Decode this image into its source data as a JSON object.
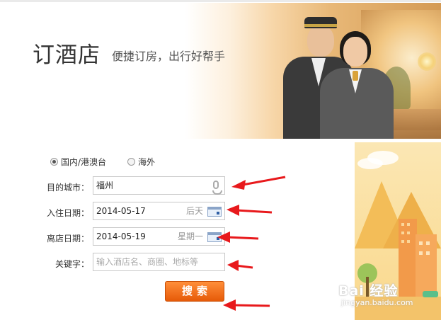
{
  "header": {
    "title": "订酒店",
    "subtitle": "便捷订房，出行好帮手"
  },
  "region": {
    "options": [
      {
        "label": "国内/港澳台",
        "selected": true
      },
      {
        "label": "海外",
        "selected": false
      }
    ]
  },
  "form": {
    "city": {
      "label": "目的城市：",
      "value": "福州",
      "icon": "microphone-icon"
    },
    "checkin": {
      "label": "入住日期：",
      "value": "2014-05-17",
      "hint": "后天",
      "icon": "calendar-icon"
    },
    "checkout": {
      "label": "离店日期：",
      "value": "2014-05-19",
      "hint": "星期一",
      "icon": "calendar-icon"
    },
    "keyword": {
      "label": "关键字：",
      "placeholder": "输入酒店名、商圈、地标等"
    },
    "search_label": "搜索"
  },
  "watermark": {
    "text": "Bai 经验",
    "sub": "jingyan.baidu.com"
  },
  "colors": {
    "accent": "#e65a08",
    "arrow": "#e8191c"
  }
}
